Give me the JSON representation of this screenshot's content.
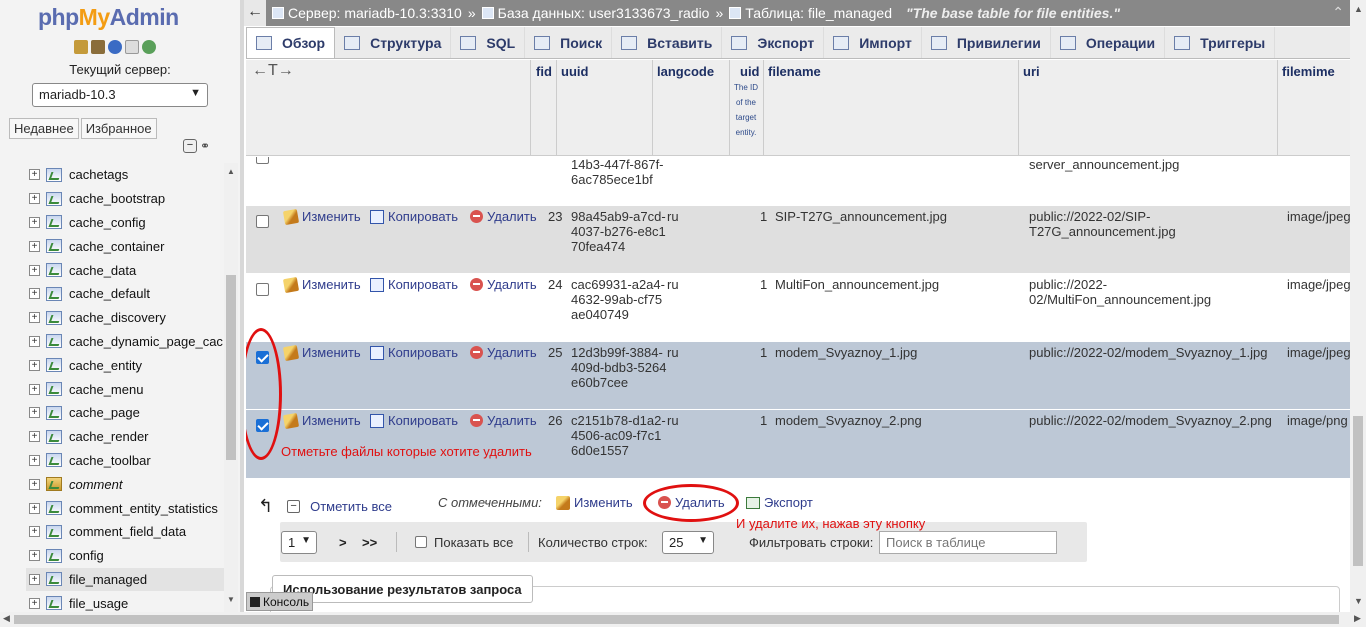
{
  "sidebar": {
    "logo_php": "php",
    "logo_my": "My",
    "logo_admin": "Admin",
    "current_server_label": "Текущий сервер:",
    "server_value": "mariadb-10.3",
    "recent_label": "Недавнее",
    "favorites_label": "Избранное",
    "tree": [
      {
        "label": "cachetags"
      },
      {
        "label": "cache_bootstrap"
      },
      {
        "label": "cache_config"
      },
      {
        "label": "cache_container"
      },
      {
        "label": "cache_data"
      },
      {
        "label": "cache_default"
      },
      {
        "label": "cache_discovery"
      },
      {
        "label": "cache_dynamic_page_cac"
      },
      {
        "label": "cache_entity"
      },
      {
        "label": "cache_menu"
      },
      {
        "label": "cache_page"
      },
      {
        "label": "cache_render"
      },
      {
        "label": "cache_toolbar"
      },
      {
        "label": "comment"
      },
      {
        "label": "comment_entity_statistics"
      },
      {
        "label": "comment_field_data"
      },
      {
        "label": "config"
      },
      {
        "label": "file_managed"
      },
      {
        "label": "file_usage"
      }
    ]
  },
  "breadcrumb": {
    "server": "Сервер: mariadb-10.3:3310",
    "database": "База данных: user3133673_radio",
    "table": "Таблица: file_managed",
    "sep": "»",
    "comment": "\"The base table for file entities.\""
  },
  "tabs": [
    {
      "label": "Обзор"
    },
    {
      "label": "Структура"
    },
    {
      "label": "SQL"
    },
    {
      "label": "Поиск"
    },
    {
      "label": "Вставить"
    },
    {
      "label": "Экспорт"
    },
    {
      "label": "Импорт"
    },
    {
      "label": "Привилегии"
    },
    {
      "label": "Операции"
    },
    {
      "label": "Триггеры"
    }
  ],
  "table": {
    "arrows": "←T→",
    "columns": {
      "fid": "fid",
      "uuid": "uuid",
      "langcode": "langcode",
      "uid": "uid",
      "uid_comment": "The ID of the target entity.",
      "filename": "filename",
      "uri": "uri",
      "filemime": "filemime"
    },
    "edit_label": "Изменить",
    "copy_label": "Копировать",
    "delete_label": "Удалить",
    "partial_row": {
      "uuid": "14b3-447f-867f-6ac785ece1bf",
      "uri": "server_announcement.jpg"
    },
    "rows": [
      {
        "fid": "23",
        "uuid": "98a45ab9-a7cd-4037-b276-e8c170fea474",
        "langcode": "ru",
        "uid": "1",
        "filename": "SIP-T27G_announcement.jpg",
        "uri": "public://2022-02/SIP-T27G_announcement.jpg",
        "filemime": "image/jpeg"
      },
      {
        "fid": "24",
        "uuid": "cac69931-a2a4-4632-99ab-cf75ae040749",
        "langcode": "ru",
        "uid": "1",
        "filename": "MultiFon_announcement.jpg",
        "uri": "public://2022-02/MultiFon_announcement.jpg",
        "filemime": "image/jpeg"
      },
      {
        "fid": "25",
        "uuid": "12d3b99f-3884-409d-bdb3-5264e60b7cee",
        "langcode": "ru",
        "uid": "1",
        "filename": "modem_Svyaznoy_1.jpg",
        "uri": "public://2022-02/modem_Svyaznoy_1.jpg",
        "filemime": "image/jpeg"
      },
      {
        "fid": "26",
        "uuid": "c2151b78-d1a2-4506-ac09-f7c16d0e1557",
        "langcode": "ru",
        "uid": "1",
        "filename": "modem_Svyaznoy_2.png",
        "uri": "public://2022-02/modem_Svyaznoy_2.png",
        "filemime": "image/png"
      }
    ]
  },
  "bulk": {
    "check_all": "Отметить все",
    "with_selected": "С отмеченными:",
    "edit": "Изменить",
    "delete": "Удалить",
    "export": "Экспорт"
  },
  "pager": {
    "page_value": "1",
    "next": ">",
    "last": ">>",
    "show_all": "Показать все",
    "rows_label": "Количество строк:",
    "rows_value": "25",
    "filter_label": "Фильтровать строки:",
    "filter_placeholder": "Поиск в таблице"
  },
  "results_tab": "Использование результатов запроса",
  "console_label": "Консоль",
  "annotations": {
    "select_files": "Отметьте файлы которые хотите удалить",
    "click_delete": "И удалите их, нажав эту кнопку"
  },
  "colors": {
    "annotation": "#e01010",
    "accent": "#2f3c8c"
  }
}
